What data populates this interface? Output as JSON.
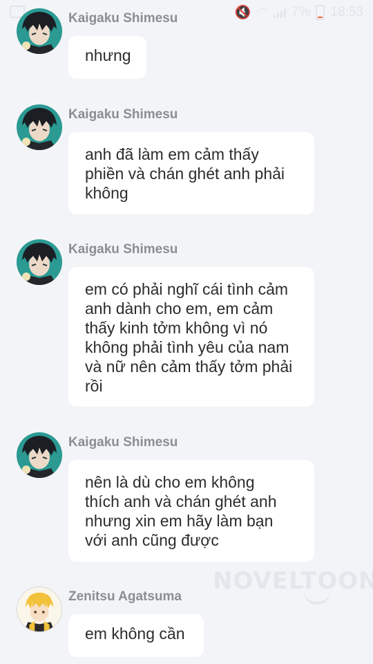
{
  "status_bar": {
    "battery_percent": "7%",
    "time": "18:53"
  },
  "messages": [
    {
      "sender": "Kaigaku Shimesu",
      "text": "nhưng",
      "avatar_icon": "kaigaku-avatar"
    },
    {
      "sender": "Kaigaku Shimesu",
      "text": "anh đã làm em cảm thấy\nphiền và chán ghét anh phải\nkhông",
      "avatar_icon": "kaigaku-avatar"
    },
    {
      "sender": "Kaigaku Shimesu",
      "text": "em có phải nghĩ cái tình cảm\nanh dành cho em, em cảm\nthấy kinh tởm không vì nó\nkhông phải tình yêu của nam\nvà nữ nên cảm thấy tởm phải\nrồi",
      "avatar_icon": "kaigaku-avatar"
    },
    {
      "sender": "Kaigaku Shimesu",
      "text": "nên là dù cho em không\nthích anh và chán ghét anh\nnhưng xin em hãy làm bạn\nvới anh cũng được",
      "avatar_icon": "kaigaku-avatar"
    },
    {
      "sender": "Zenitsu Agatsuma",
      "text": "em không cần",
      "avatar_icon": "zenitsu-avatar"
    }
  ],
  "watermark": "NOVELTOON",
  "colors": {
    "background": "#f3f4f7",
    "bubble": "#ffffff",
    "sender_name": "#8a8d94",
    "message_text": "#2c2c2c"
  }
}
